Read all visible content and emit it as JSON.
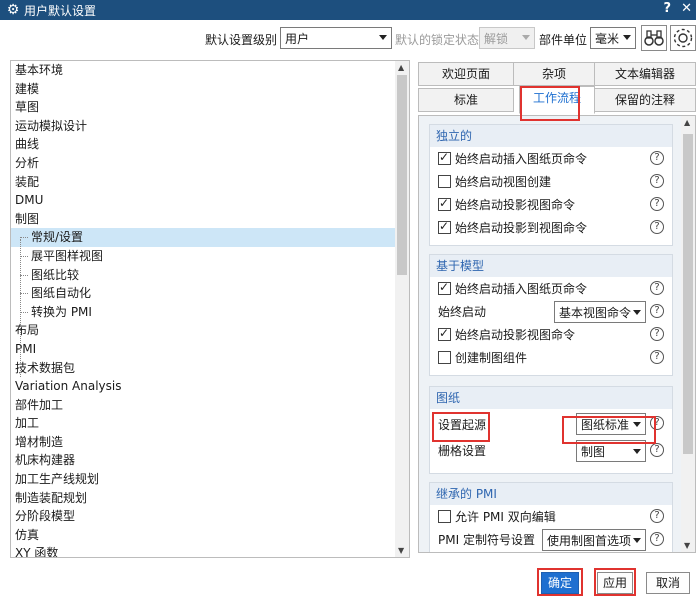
{
  "window": {
    "title": "用户默认设置",
    "help_glyph": "?",
    "close_glyph": "✕"
  },
  "toolbar": {
    "level_label": "默认设置级别",
    "level_value": "用户",
    "lock_label": "默认的锁定状态",
    "lock_value": "解锁",
    "unit_label": "部件单位",
    "unit_value": "毫米"
  },
  "tree": {
    "items": [
      "基本环境",
      "建模",
      "草图",
      "运动模拟设计",
      "曲线",
      "分析",
      "装配",
      "DMU",
      "制图",
      "常规/设置",
      "展平图样视图",
      "图纸比较",
      "图纸自动化",
      "转换为 PMI",
      "布局",
      "PMI",
      "技术数据包",
      "Variation Analysis",
      "部件加工",
      "加工",
      "增材制造",
      "机床构建器",
      "加工生产线规划",
      "制造装配规划",
      "分阶段模型",
      "仿真",
      "XY 函数"
    ],
    "selected": "常规/设置"
  },
  "tabs": {
    "row1": [
      "欢迎页面",
      "杂项",
      "文本编辑器"
    ],
    "row2": [
      "标准",
      "工作流程",
      "保留的注释"
    ],
    "active": "工作流程"
  },
  "groups": {
    "independent": {
      "title": "独立的",
      "items": [
        {
          "label": "始终启动插入图纸页命令",
          "checked": true
        },
        {
          "label": "始终启动视图创建",
          "checked": false
        },
        {
          "label": "始终启动投影视图命令",
          "checked": true
        },
        {
          "label": "始终启动投影到视图命令",
          "checked": true
        }
      ]
    },
    "model_based": {
      "title": "基于模型",
      "item1": {
        "label": "始终启动插入图纸页命令",
        "checked": true
      },
      "start_label": "始终启动",
      "start_value": "基本视图命令",
      "item2": {
        "label": "始终启动投影视图命令",
        "checked": true
      },
      "item3": {
        "label": "创建制图组件",
        "checked": false
      }
    },
    "drawing": {
      "title": "图纸",
      "origin_label": "设置起源",
      "origin_value": "图纸标准",
      "grid_label": "栅格设置",
      "grid_value": "制图"
    },
    "inherited_pmi": {
      "title": "继承的 PMI",
      "allow_label": "允许 PMI 双向编辑",
      "allow_checked": false,
      "symbol_label": "PMI 定制符号设置",
      "symbol_value": "使用制图首选项"
    }
  },
  "help_glyph": "?",
  "buttons": {
    "ok": "确定",
    "apply": "应用",
    "cancel": "取消"
  },
  "colors": {
    "titlebar": "#1d4f7e",
    "accent": "#1e6fd0",
    "highlight": "#e0332f",
    "selection": "#cde6f7"
  }
}
